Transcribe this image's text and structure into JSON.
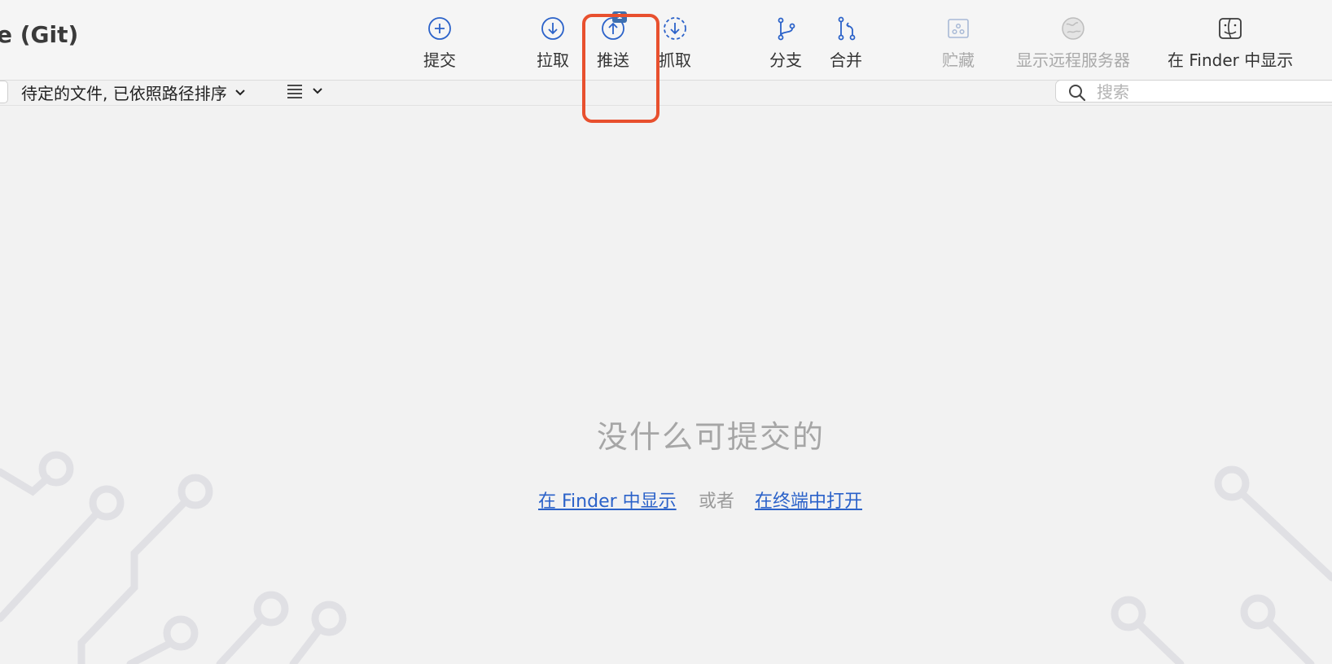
{
  "repo_title": "e (Git)",
  "toolbar": {
    "buttons": [
      {
        "label": "提交",
        "icon": "plus-circle-icon"
      },
      {
        "label": "拉取",
        "icon": "arrow-down-circle-icon"
      },
      {
        "label": "推送",
        "icon": "arrow-up-circle-icon",
        "badge": "1"
      },
      {
        "label": "抓取",
        "icon": "dashed-arrow-down-circle-icon"
      },
      {
        "label": "分支",
        "icon": "branch-icon"
      },
      {
        "label": "合并",
        "icon": "merge-icon"
      },
      {
        "label": "贮藏",
        "icon": "stash-icon",
        "disabled": true
      },
      {
        "label": "显示远程服务器",
        "icon": "globe-icon",
        "disabled": true
      },
      {
        "label": "在 Finder 中显示",
        "icon": "finder-icon"
      }
    ]
  },
  "subbar": {
    "sort_label": "待定的文件, 已依照路径排序",
    "view_icon": "list-icon",
    "search_placeholder": "搜索"
  },
  "empty_state": {
    "title": "没什么可提交的",
    "show_in_finder_link": "在 Finder 中显示",
    "or_text": "或者",
    "open_terminal_link": "在终端中打开"
  },
  "colors": {
    "accent": "#2b62c9",
    "highlight": "#e8502e",
    "background": "#f2f2f2"
  }
}
